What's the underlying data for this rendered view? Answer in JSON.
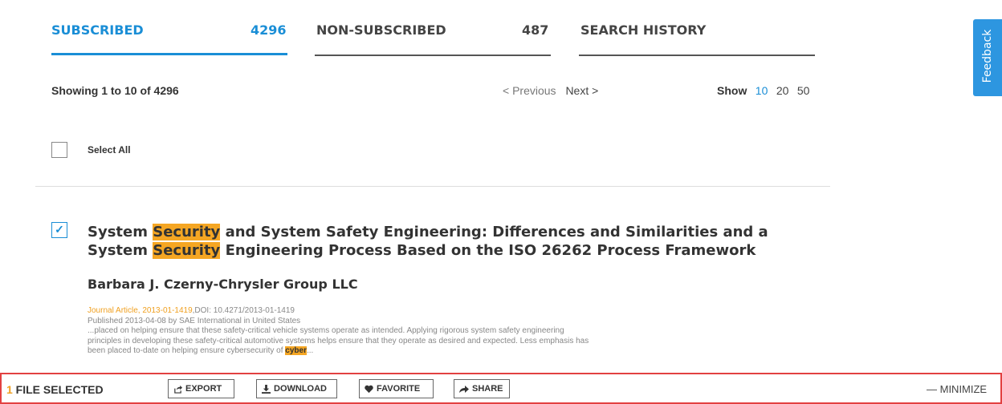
{
  "tabs": [
    {
      "label": "SUBSCRIBED",
      "count": "4296"
    },
    {
      "label": "NON-SUBSCRIBED",
      "count": "487"
    },
    {
      "label": "SEARCH HISTORY",
      "count": ""
    }
  ],
  "feedback_label": "Feedback",
  "results_summary": "Showing 1 to 10 of 4296",
  "pagination": {
    "previous": "< Previous",
    "next": "Next >"
  },
  "page_size": {
    "label": "Show",
    "options": [
      "10",
      "20",
      "50"
    ],
    "selected": "10"
  },
  "select_all_label": "Select All",
  "result": {
    "title_line1": {
      "pre": "System ",
      "hl": "Security",
      "post": " and System Safety Engineering: Differences and Similarities and a"
    },
    "title_line2": {
      "pre": "System ",
      "hl": "Security",
      "post": " Engineering Process Based on the ISO 26262 Process Framework"
    },
    "author": "Barbara J. Czerny-Chrysler Group LLC",
    "type_id": "Journal Article, 2013-01-1419",
    "doi": ",DOI: 10.4271/2013-01-1419",
    "published": "Published 2013-04-08 by SAE International in United States",
    "snippet_line1": "...placed on helping ensure that these safety-critical vehicle systems operate as intended. Applying rigorous system safety engineering",
    "snippet_line2": "principles in developing these safety-critical automotive systems helps ensure that they operate as desired and expected. Less emphasis has",
    "snippet_line3_pre": "been placed to-date on helping ensure cybersecurity of ",
    "snippet_line3_hl": "cyber",
    "snippet_line3_post": "..."
  },
  "bottom_bar": {
    "count": "1",
    "label": " FILE SELECTED",
    "actions": {
      "export": "EXPORT",
      "download": "DOWNLOAD",
      "favorite": "FAVORITE",
      "share": "SHARE"
    },
    "minimize": "— MINIMIZE"
  }
}
